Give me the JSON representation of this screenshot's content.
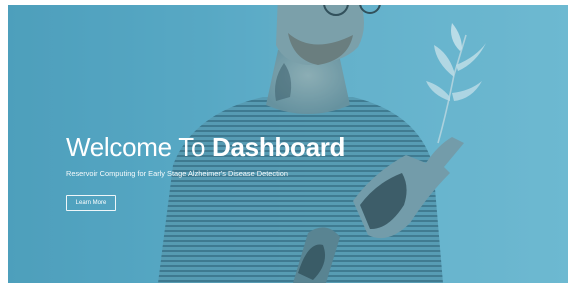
{
  "hero": {
    "title_prefix": "Welcome To ",
    "title_strong": "Dashboard",
    "subtitle": "Reservoir Computing for Early Stage Alzheimer's Disease Detection",
    "cta_label": "Learn More"
  },
  "colors": {
    "overlay_tint": "#5aaac4",
    "text": "#ffffff"
  }
}
